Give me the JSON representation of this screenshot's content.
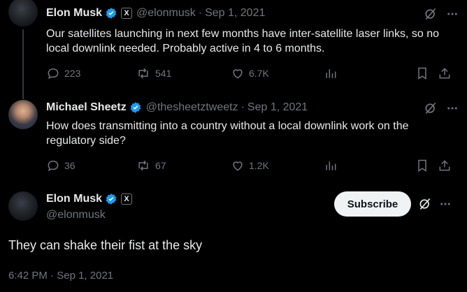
{
  "tweets": [
    {
      "name": "Elon Musk",
      "handle": "@elonmusk",
      "separator": "·",
      "date": "Sep 1, 2021",
      "text": "Our satellites launching in next few months have inter-satellite laser links, so no local downlink needed. Probably active in 4 to 6 months.",
      "replies": "223",
      "retweets": "541",
      "likes": "6.7K"
    },
    {
      "name": "Michael Sheetz",
      "handle": "@thesheetztweetz",
      "separator": "·",
      "date": "Sep 1, 2021",
      "text": "How does transmitting into a country without a local downlink work on the regulatory side?",
      "replies": "36",
      "retweets": "67",
      "likes": "1.2K"
    }
  ],
  "main": {
    "name": "Elon Musk",
    "handle": "@elonmusk",
    "subscribe_label": "Subscribe",
    "text": "They can shake their fist at the sky",
    "time": "6:42 PM",
    "separator": "·",
    "date": "Sep 1, 2021"
  },
  "badges": {
    "x_badge": "X"
  },
  "colors": {
    "background": "#000000",
    "text": "#e7e9ea",
    "muted": "#71767b",
    "verified": "#1d9bf0",
    "button_bg": "#eff3f4"
  },
  "icons": [
    "verified-badge-icon",
    "x-affiliate-badge-icon",
    "grok-icon",
    "more-icon",
    "reply-icon",
    "retweet-icon",
    "like-icon",
    "views-icon",
    "bookmark-icon",
    "share-icon"
  ]
}
